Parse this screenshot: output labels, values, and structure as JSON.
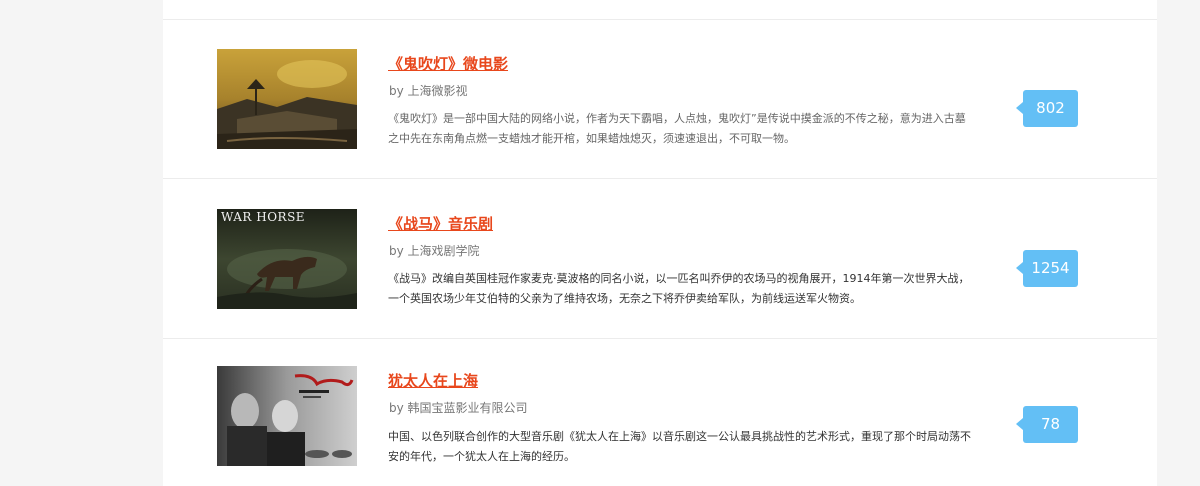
{
  "items": [
    {
      "title": "《鬼吹灯》微电影",
      "byline": "by 上海微影视",
      "description": "《鬼吹灯》是一部中国大陆的网络小说，作者为天下霸唱，人点烛，鬼吹灯”是传说中摸金派的不传之秘，意为进入古墓之中先在东南角点燃一支蜡烛才能开棺，如果蜡烛熄灭，须速速退出，不可取一物。",
      "count": "802"
    },
    {
      "title": "《战马》音乐剧",
      "byline": "by 上海戏剧学院",
      "description": "《战马》改编自英国桂冠作家麦克·莫波格的同名小说，以一匹名叫乔伊的农场马的视角展开，1914年第一次世界大战，一个英国农场少年艾伯特的父亲为了维持农场，无奈之下将乔伊卖给军队，为前线运送军火物资。",
      "count": "1254",
      "poster_text": "WAR HORSE"
    },
    {
      "title": "犹太人在上海",
      "byline": "by 韩国宝蓝影业有限公司",
      "description": "中国、以色列联合创作的大型音乐剧《犹太人在上海》以音乐剧这一公认最具挑战性的艺术形式，重现了那个时局动荡不安的年代，一个犹太人在上海的经历。",
      "count": "78"
    }
  ],
  "colors": {
    "title": "#e8471c",
    "badge": "#63bff5",
    "background": "#f5f5f5",
    "panel": "#ffffff"
  }
}
